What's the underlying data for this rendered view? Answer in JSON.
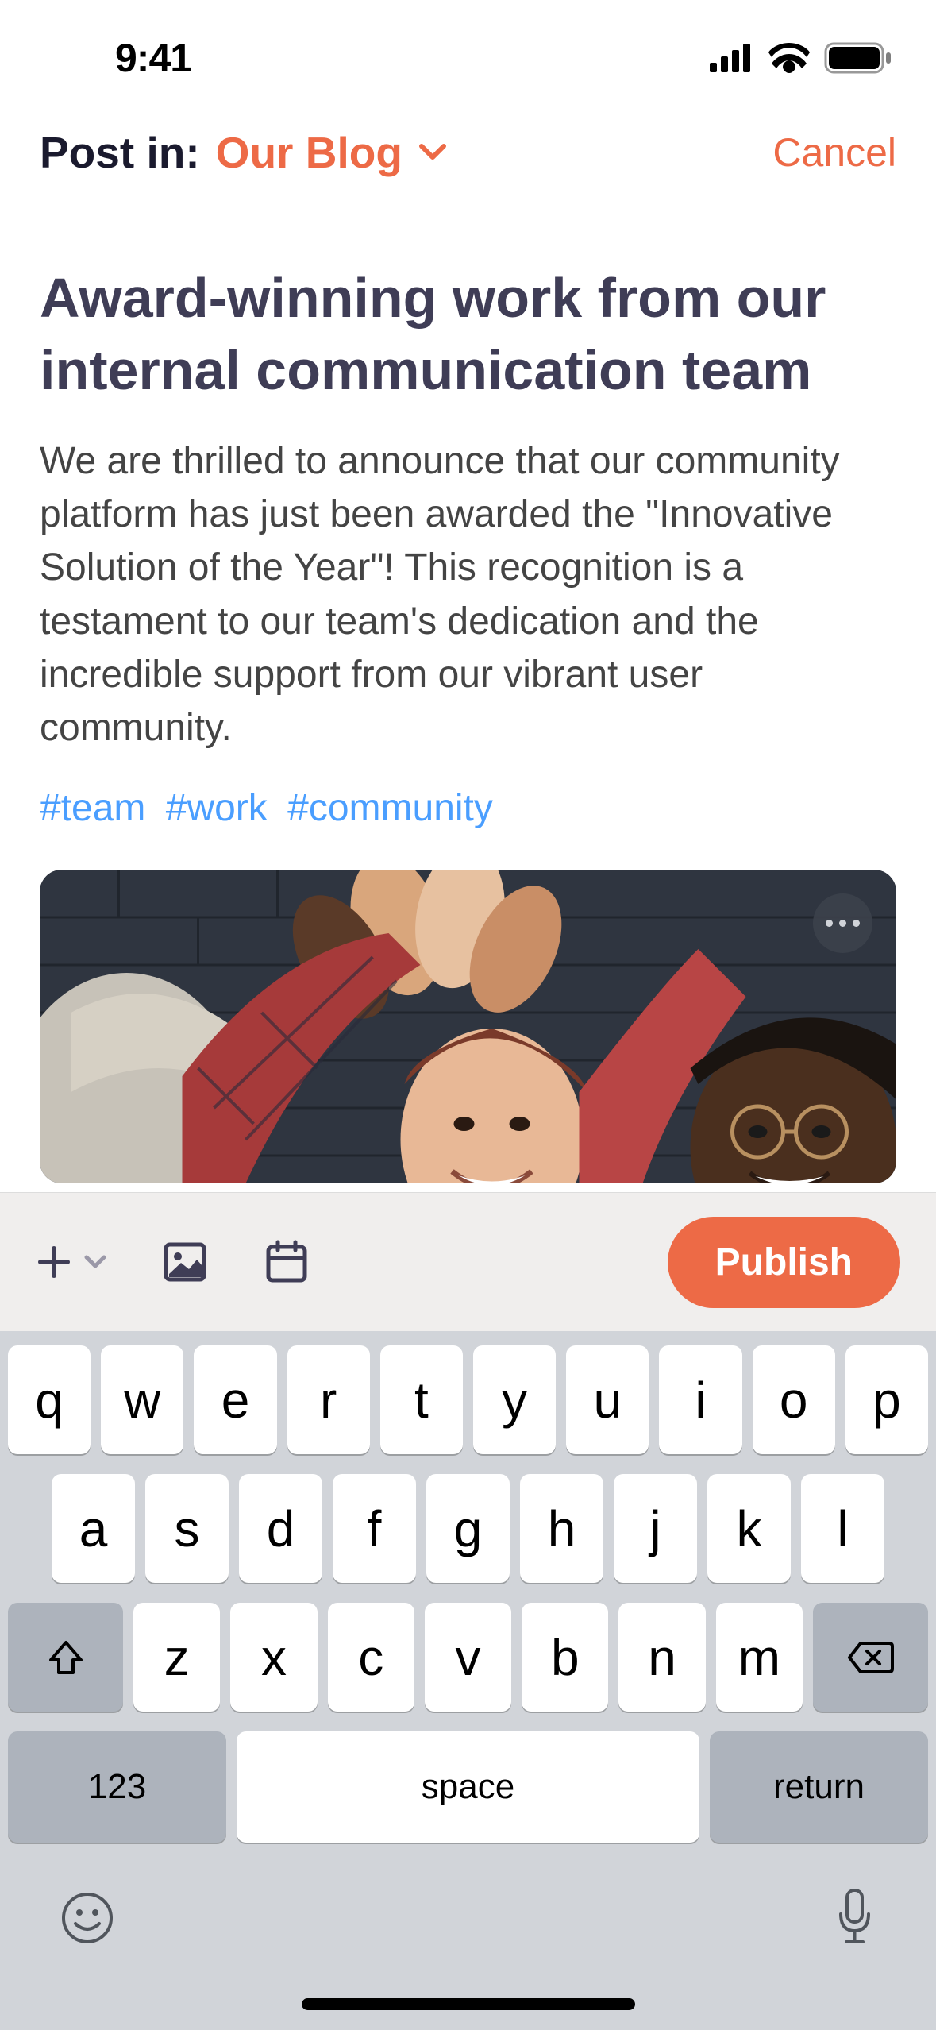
{
  "status": {
    "time": "9:41"
  },
  "header": {
    "post_in_label": "Post in:",
    "blog_name": "Our Blog",
    "cancel": "Cancel"
  },
  "post": {
    "title": "Award-winning work from our internal communication team",
    "body": "We are thrilled to announce that our community platform has just been awarded the \"Innovative Solution of the Year\"! This recognition is a testament to our team's dedication and the incredible support from our vibrant user community.",
    "hashtags": [
      "#team",
      "#work",
      "#community"
    ]
  },
  "toolbar": {
    "publish": "Publish"
  },
  "keyboard": {
    "row1": [
      "q",
      "w",
      "e",
      "r",
      "t",
      "y",
      "u",
      "i",
      "o",
      "p"
    ],
    "row2": [
      "a",
      "s",
      "d",
      "f",
      "g",
      "h",
      "j",
      "k",
      "l"
    ],
    "row3": [
      "z",
      "x",
      "c",
      "v",
      "b",
      "n",
      "m"
    ],
    "num": "123",
    "space": "space",
    "return": "return"
  }
}
